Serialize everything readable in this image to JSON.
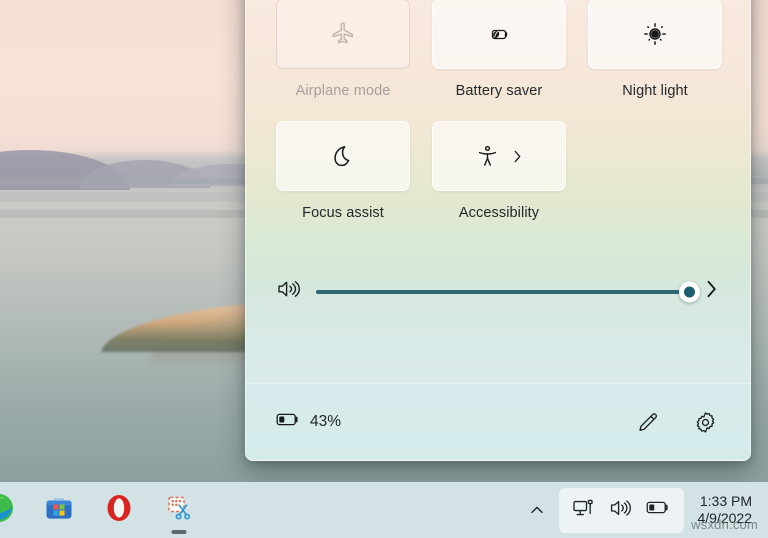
{
  "desktop": {
    "wallpaper_name": "lake-at-dusk-wallpaper"
  },
  "quick_settings": {
    "tiles": [
      {
        "id": "airplane-mode",
        "label": "Airplane mode",
        "icon": "airplane-icon",
        "state": "off",
        "has_chevron": false
      },
      {
        "id": "battery-saver",
        "label": "Battery saver",
        "icon": "battery-leaf-icon",
        "state": "on",
        "has_chevron": false
      },
      {
        "id": "night-light",
        "label": "Night light",
        "icon": "brightness-sun-icon",
        "state": "on",
        "has_chevron": false
      },
      {
        "id": "focus-assist",
        "label": "Focus assist",
        "icon": "moon-icon",
        "state": "on",
        "has_chevron": false
      },
      {
        "id": "accessibility",
        "label": "Accessibility",
        "icon": "accessibility-person-icon",
        "state": "on",
        "has_chevron": true
      }
    ],
    "volume": {
      "icon": "volume-high-icon",
      "value": 100,
      "min": 0,
      "max": 100,
      "expand_icon": "chevron-right-icon",
      "accent_color": "#2f6673"
    },
    "footer": {
      "battery_icon": "battery-low-icon",
      "battery_percent": "43%",
      "edit_icon": "pencil-icon",
      "settings_icon": "gear-icon"
    }
  },
  "taskbar": {
    "apps": [
      {
        "id": "edge",
        "name": "edge-icon",
        "active": false
      },
      {
        "id": "microsoft-store",
        "name": "microsoft-store-icon",
        "active": false
      },
      {
        "id": "opera",
        "name": "opera-icon",
        "active": false
      },
      {
        "id": "snipping-tool",
        "name": "snipping-tool-icon",
        "active": true
      }
    ],
    "tray": {
      "chevron_icon": "chevron-up-icon",
      "network_icon": "network-monitor-icon",
      "volume_icon": "volume-high-icon",
      "battery_icon": "battery-low-icon"
    },
    "clock": {
      "time": "1:33 PM",
      "date": "4/9/2022"
    }
  },
  "watermark": {
    "text": "wsxdn.com"
  }
}
